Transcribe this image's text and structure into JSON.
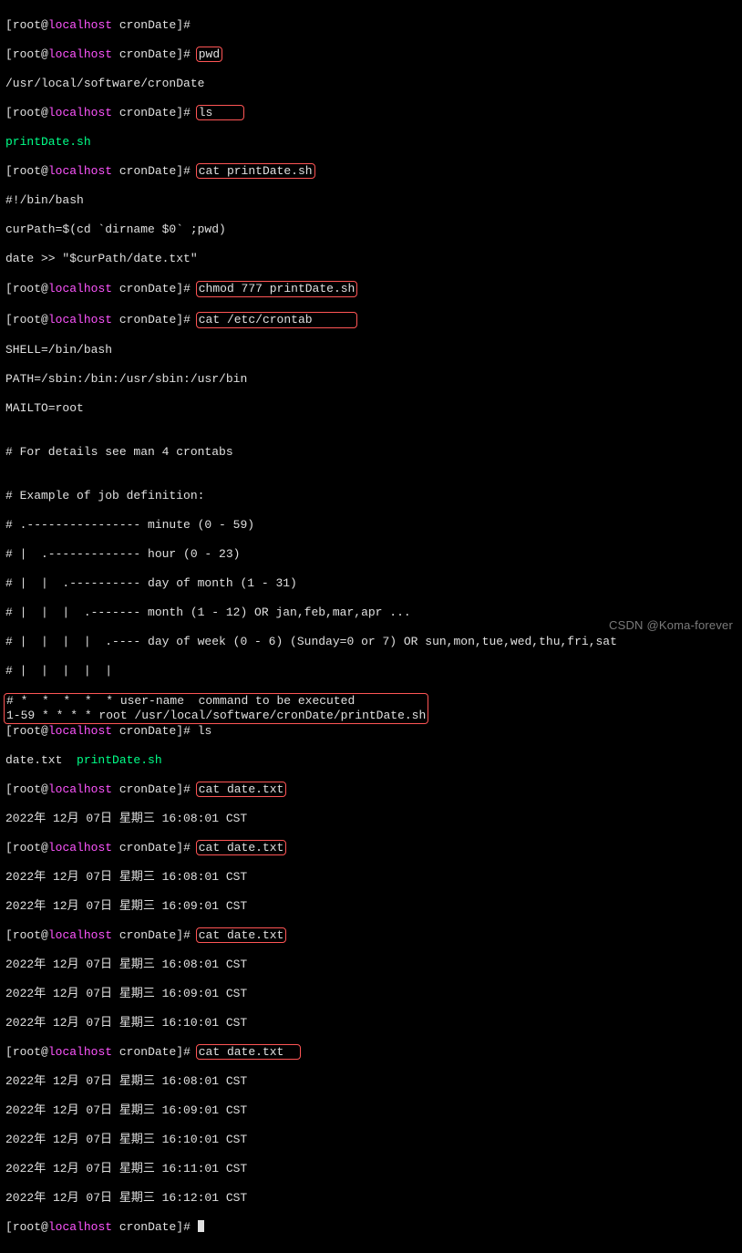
{
  "prompt": {
    "user": "root",
    "at": "@",
    "host": "localhost",
    "path": "cronDate",
    "hash": "#"
  },
  "cmds": {
    "pwd": "pwd",
    "ls": "ls",
    "cat_print": "cat printDate.sh",
    "chmod": "chmod 777 printDate.sh",
    "cat_crontab": "cat /etc/crontab",
    "ls2": "ls",
    "cat_date1": "cat date.txt",
    "cat_date2": "cat date.txt",
    "cat_date3": "cat date.txt",
    "cat_date4": "cat date.txt"
  },
  "output": {
    "pwd_out": "/usr/local/software/cronDate",
    "ls1_out": "printDate.sh",
    "script": {
      "l1": "#!/bin/bash",
      "l2": "curPath=$(cd `dirname $0` ;pwd)",
      "l3": "date >> \"$curPath/date.txt\""
    },
    "crontab": {
      "l1": "SHELL=/bin/bash",
      "l2": "PATH=/sbin:/bin:/usr/sbin:/usr/bin",
      "l3": "MAILTO=root",
      "l4": "",
      "l5": "# For details see man 4 crontabs",
      "l6": "",
      "l7": "# Example of job definition:",
      "l8": "# .---------------- minute (0 - 59)",
      "l9": "# |  .------------- hour (0 - 23)",
      "l10": "# |  |  .---------- day of month (1 - 31)",
      "l11": "# |  |  |  .------- month (1 - 12) OR jan,feb,mar,apr ...",
      "l12": "# |  |  |  |  .---- day of week (0 - 6) (Sunday=0 or 7) OR sun,mon,tue,wed,thu,fri,sat",
      "l13": "# |  |  |  |  |",
      "l14": "# *  *  *  *  * user-name  command to be executed",
      "cronline": "1-59 * * * * root /usr/local/software/cronDate/printDate.sh"
    },
    "ls2_out_a": "date.txt  ",
    "ls2_out_b": "printDate.sh",
    "dates": {
      "d1": "2022年 12月 07日 星期三 16:08:01 CST",
      "d2": "2022年 12月 07日 星期三 16:08:01 CST",
      "d3": "2022年 12月 07日 星期三 16:09:01 CST",
      "d4": "2022年 12月 07日 星期三 16:08:01 CST",
      "d5": "2022年 12月 07日 星期三 16:09:01 CST",
      "d6": "2022年 12月 07日 星期三 16:10:01 CST",
      "d7": "2022年 12月 07日 星期三 16:08:01 CST",
      "d8": "2022年 12月 07日 星期三 16:09:01 CST",
      "d9": "2022年 12月 07日 星期三 16:10:01 CST",
      "d10": "2022年 12月 07日 星期三 16:11:01 CST",
      "d11": "2022年 12月 07日 星期三 16:12:01 CST"
    }
  },
  "watermark": "CSDN @Koma-forever"
}
